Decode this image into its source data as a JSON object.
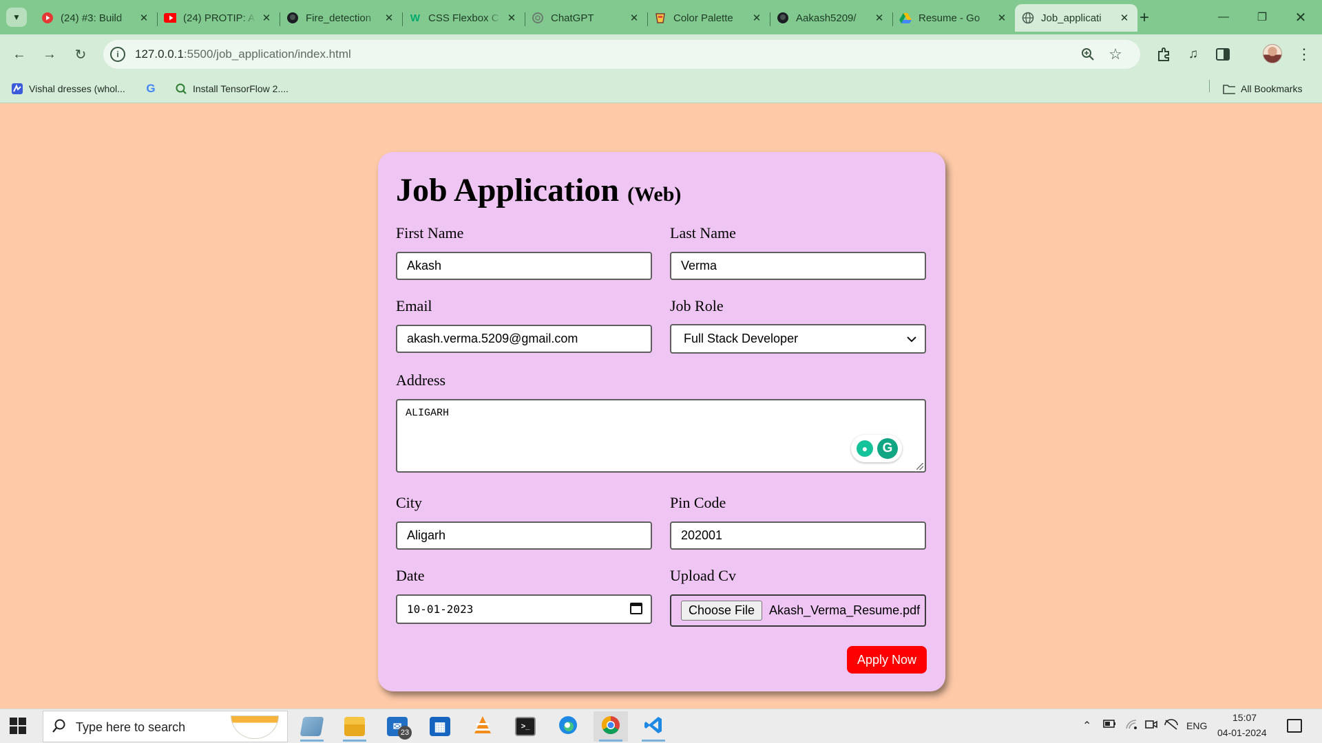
{
  "browser": {
    "tabs": [
      {
        "title": "(24) #3: Build",
        "favicon": "youtube-icon",
        "active": false
      },
      {
        "title": "(24) PROTIP: A",
        "favicon": "youtube-icon",
        "active": false
      },
      {
        "title": "Fire_detection",
        "favicon": "github-icon",
        "active": false
      },
      {
        "title": "CSS Flexbox C",
        "favicon": "w3schools-icon",
        "active": false
      },
      {
        "title": "ChatGPT",
        "favicon": "chatgpt-icon",
        "active": false
      },
      {
        "title": "Color Palette",
        "favicon": "palette-icon",
        "active": false
      },
      {
        "title": "Aakash5209/",
        "favicon": "github-icon",
        "active": false
      },
      {
        "title": "Resume - Go",
        "favicon": "google-drive-icon",
        "active": false
      },
      {
        "title": "Job_applicati",
        "favicon": "globe-icon",
        "active": true
      }
    ],
    "url_host": "127.0.0.1",
    "url_rest": ":5500/job_application/index.html",
    "bookmarks": [
      {
        "label": "Vishal dresses (whol...",
        "icon": "bookmark-site-icon"
      },
      {
        "label": "",
        "icon": "google-icon"
      },
      {
        "label": "Install TensorFlow 2....",
        "icon": "search-bookmark-icon"
      }
    ],
    "all_bookmarks": "All Bookmarks"
  },
  "form": {
    "title": "Job Application",
    "subtitle": "(Web)",
    "first_name": {
      "label": "First Name",
      "value": "Akash"
    },
    "last_name": {
      "label": "Last Name",
      "value": "Verma"
    },
    "email": {
      "label": "Email",
      "value": "akash.verma.5209@gmail.com"
    },
    "job_role": {
      "label": "Job Role",
      "value": "Full Stack Developer"
    },
    "address": {
      "label": "Address",
      "value": "ALIGARH"
    },
    "city": {
      "label": "City",
      "value": "Aligarh"
    },
    "pin_code": {
      "label": "Pin Code",
      "value": "202001"
    },
    "date": {
      "label": "Date",
      "value": "10-01-2023"
    },
    "upload_cv": {
      "label": "Upload Cv",
      "button": "Choose File",
      "filename": "Akash_Verma_Resume.pdf"
    },
    "submit": "Apply Now",
    "colors": {
      "page_bg": "#fdc9a7",
      "card_bg": "#efc6f3",
      "button": "#ff0000"
    }
  },
  "taskbar": {
    "search_placeholder": "Type here to search",
    "mail_badge": "23",
    "language": "ENG",
    "time": "15:07",
    "date": "04-01-2024"
  }
}
